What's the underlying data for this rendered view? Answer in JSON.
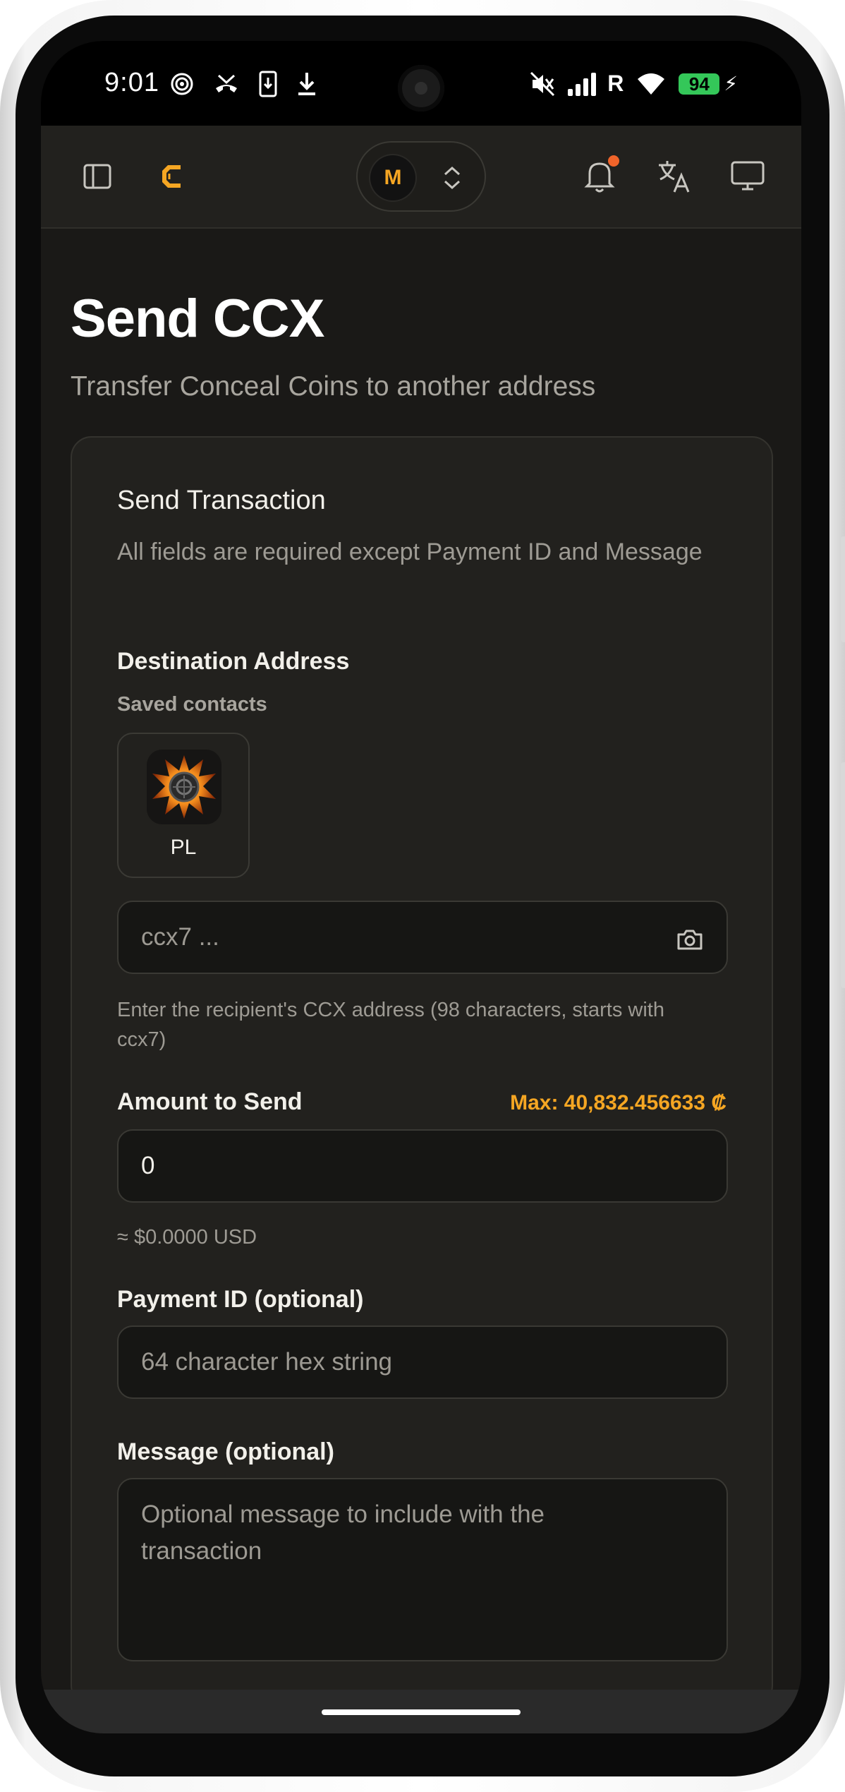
{
  "status_bar": {
    "time": "9:01",
    "battery": "94",
    "carrier_flag": "R",
    "icons": [
      "wireless-hotspot-icon",
      "missed-call-icon",
      "download-phone-icon",
      "download-icon",
      "mute-icon",
      "signal-icon",
      "wifi-icon",
      "battery-icon",
      "charging-icon"
    ]
  },
  "header": {
    "wallet_initial": "M",
    "icons": [
      "sidebar-toggle-icon",
      "app-logo-icon",
      "chevron-up-down-icon",
      "bell-icon",
      "translate-icon",
      "monitor-icon"
    ],
    "accent": "#f5a623",
    "notification_dot_color": "#f0642a"
  },
  "page": {
    "title": "Send CCX",
    "subtitle": "Transfer Conceal Coins to another address"
  },
  "form": {
    "title": "Send Transaction",
    "description": "All fields are required except Payment ID and Message",
    "destination": {
      "label": "Destination Address",
      "saved_contacts_label": "Saved contacts",
      "contacts": [
        {
          "name": "PL"
        }
      ],
      "placeholder": "ccx7 ...",
      "help": "Enter the recipient's CCX address (98 characters, starts with ccx7)"
    },
    "amount": {
      "label": "Amount to Send",
      "max": "Max: 40,832.456633 ₡",
      "value": "0",
      "usd_estimate": "≈ $0.0000 USD"
    },
    "payment_id": {
      "label": "Payment ID (optional)",
      "placeholder": "64 character hex string"
    },
    "message": {
      "label": "Message (optional)",
      "placeholder": "Optional message to include with the transaction"
    }
  }
}
